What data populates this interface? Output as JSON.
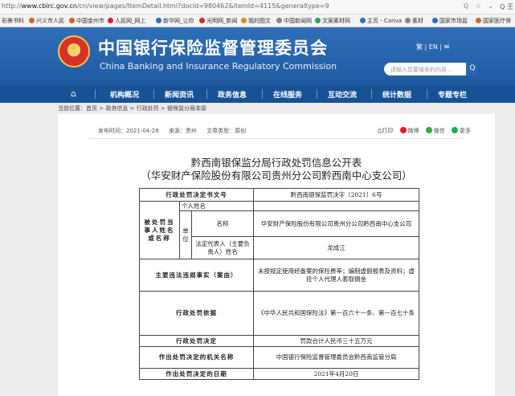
{
  "browser": {
    "url_prefix": "http://",
    "url_domain": "www.cbirc.gov.cn",
    "url_path": "/cn/view/pages/ItemDetail.html?docId=980462&itemId=4115&generaltype=9",
    "tool_icons": "ℚ ☆ ⌄",
    "search_glyph": "Q 王"
  },
  "bookmarks": [
    {
      "label": "彩美书料",
      "color": ""
    },
    {
      "label": "兴义市人民",
      "color": "#e0611f"
    },
    {
      "label": "中国金州市",
      "color": "#e0611f"
    },
    {
      "label": "人民网_网上",
      "color": "#d8232a"
    },
    {
      "label": "新华网_让你",
      "color": "#2a6fc9"
    },
    {
      "label": "光明网_新闻",
      "color": "#d8232a"
    },
    {
      "label": "我的图文",
      "color": "#e08a1f"
    },
    {
      "label": "中国新闻网",
      "color": "#888888"
    },
    {
      "label": "文案素材网",
      "color": "#2fa24a"
    },
    {
      "label": "主页 - Canva",
      "color": "#2a6fc9"
    },
    {
      "label": "素材",
      "color": "#888888"
    },
    {
      "label": "国家市场监",
      "color": "#2a6fc9"
    },
    {
      "label": "国家医疗保",
      "color": "#e0611f"
    }
  ],
  "header": {
    "title_cn": "中国银行保险监督管理委员会",
    "title_en": "China Banking and Insurance Regulatory Commission",
    "lang_links": "繁  |  EN  |  ✉",
    "search_placeholder": "请输入您要搜索的内容...",
    "search_button": "Q"
  },
  "nav": {
    "home_glyph": "⌂",
    "items": [
      "机构概况",
      "新闻资讯",
      "政务信息",
      "在线服务",
      "互动交流",
      "统计数据",
      "专题专栏"
    ]
  },
  "breadcrumb": "当前位置：首页 > 政务信息 > 行政处罚 > 银保监分局本级",
  "meta": {
    "publish_time": "发布时间：2021-04-28",
    "source": "来源：贵州",
    "doc_type": "文章类型：原创"
  },
  "share": {
    "print": "⎙打印",
    "weibo": "微博",
    "wechat": "微信",
    "more": "更多",
    "colors": {
      "print": "#666666",
      "weibo": "#e6162d",
      "wechat": "#2fb03a",
      "more": "#1fae5b"
    }
  },
  "article": {
    "title": "黔西南银保监分局行政处罚信息公开表",
    "subtitle": "（华安财产保险股份有限公司贵州分公司黔西南中心支公司）"
  },
  "table": {
    "doc_number_label": "行政处罚决定书文号",
    "doc_number_value": "黔西南银保监罚决字〔2021〕6号",
    "party_label": "被处罚当事人姓名或名称",
    "individual_label": "个人姓名",
    "individual_value": "",
    "unit_label": "单位",
    "name_label": "名称",
    "name_value": "华安财产保险股份有限公司贵州分公司黔西南中心支公司",
    "legal_rep_label": "法定代表人（主要负责人）姓名",
    "legal_rep_value": "龙成江",
    "violation_label": "主要违法违规事实（案由）",
    "violation_value": "未按规定使用经备案的保险费率；编制虚假报表及资料；虚挂个人代理人套取佣金",
    "basis_label": "行政处罚依据",
    "basis_value": "《中华人民共和国保险法》第一百六十一条、第一百七十条",
    "decision_label": "行政处罚决定",
    "decision_value": "罚款合计人民币三十五万元",
    "authority_label": "作出处罚决定的机关名称",
    "authority_value": "中国银行保险监督管理委员会黔西南监管分局",
    "date_label": "作出处罚决定的日期",
    "date_value": "2021年4月20日"
  }
}
